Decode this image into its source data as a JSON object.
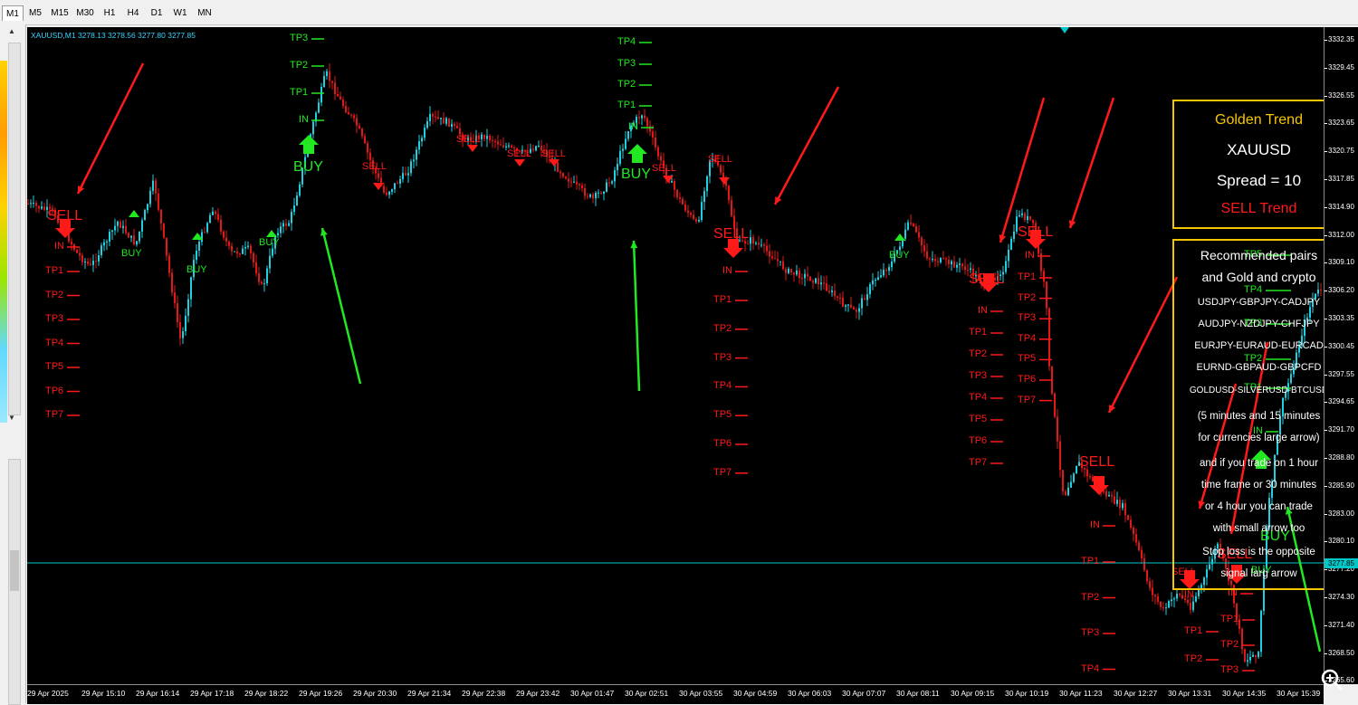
{
  "toolbar": {
    "timeframes": [
      "M1",
      "M5",
      "M15",
      "M30",
      "H1",
      "H4",
      "D1",
      "W1",
      "MN"
    ],
    "active": "M1"
  },
  "chart": {
    "symbol_line": "XAUUSD,M1  3278.13 3278.56 3277.80 3277.85",
    "current_price": "3277.85",
    "price_ticks": [
      "3332.35",
      "3329.45",
      "3326.55",
      "3323.65",
      "3320.75",
      "3317.85",
      "3314.90",
      "3312.00",
      "3309.10",
      "3306.20",
      "3303.35",
      "3300.45",
      "3297.55",
      "3294.65",
      "3291.70",
      "3288.80",
      "3285.90",
      "3283.00",
      "3280.10",
      "3277.20",
      "3274.30",
      "3271.40",
      "3268.50",
      "3265.60"
    ],
    "time_ticks": [
      "29 Apr 2025",
      "29 Apr 15:10",
      "29 Apr 16:14",
      "29 Apr 17:18",
      "29 Apr 18:22",
      "29 Apr 19:26",
      "29 Apr 20:30",
      "29 Apr 21:34",
      "29 Apr 22:38",
      "29 Apr 23:42",
      "30 Apr 01:47",
      "30 Apr 02:51",
      "30 Apr 03:55",
      "30 Apr 04:59",
      "30 Apr 06:03",
      "30 Apr 07:07",
      "30 Apr 08:11",
      "30 Apr 09:15",
      "30 Apr 10:19",
      "30 Apr 11:23",
      "30 Apr 12:27",
      "30 Apr 13:31",
      "30 Apr 14:35",
      "30 Apr 15:39"
    ]
  },
  "signals": {
    "sell": "SELL",
    "buy": "BUY",
    "entry": "IN",
    "tp": [
      "TP1",
      "TP2",
      "TP3",
      "TP4",
      "TP5",
      "TP6",
      "TP7"
    ]
  },
  "panel1": {
    "title": "Golden Trend",
    "symbol": "XAUUSD",
    "spread": "Spread = 10",
    "trend": "SELL Trend",
    "title_color": "#f7c600",
    "trend_color": "#ff1a1a"
  },
  "panel2": {
    "lines": [
      "Recommended pairs",
      "and Gold and crypto",
      "USDJPY-GBPJPY-CADJPY",
      "AUDJPY-NZDJPY-CHFJPY",
      "EURJPY-EURAUD-EURCAD",
      "EURND-GBPAUD-GBPCFD",
      "GOLDUSD-SILVERUSD-BTCUSD",
      "(5 minutes and 15 minutes",
      "for currencies large arrow)",
      "and if you trade on 1 hour",
      "time frame or 30 minutes",
      "or 4 hour you can trade",
      "with small arrow too",
      "Stop loss is the opposite",
      "signal larg arrow"
    ]
  },
  "colors": {
    "candle_up": "#20d0e0",
    "candle_down": "#e01818",
    "sell": "#ff1a1a",
    "buy": "#22e822",
    "panel_border": "#f7c600",
    "price_line": "#00c8c8"
  }
}
